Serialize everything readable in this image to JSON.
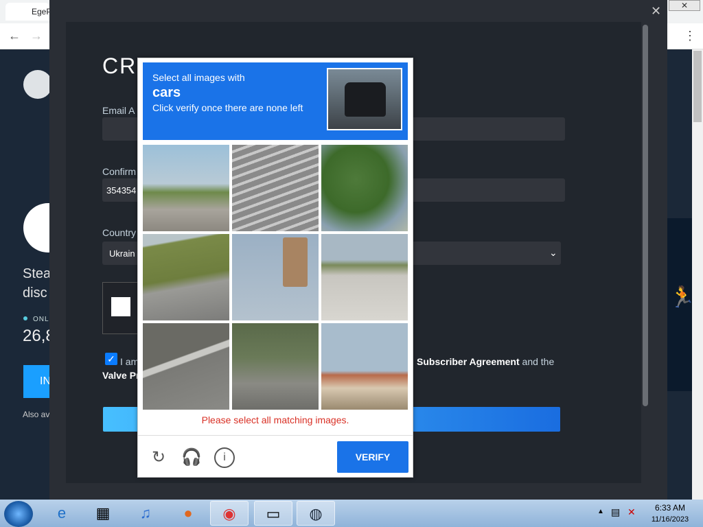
{
  "browser": {
    "tab_title": "EgeP",
    "window_close_glyph": "✕",
    "back_glyph": "←",
    "forward_glyph": "→",
    "menu_glyph": "⋮"
  },
  "steam_page": {
    "side_text_line1": "Stea",
    "side_text_line2": "disc",
    "online_label": "ONLI",
    "online_count": "26,8",
    "install_button": "IN",
    "also_available": "Also av",
    "accent_color": "#1a9fff"
  },
  "modal": {
    "close_glyph": "✕",
    "title": "CR",
    "email_label": "Email A",
    "confirm_label": "Confirm",
    "confirm_value": "354354",
    "country_label": "Country",
    "country_value": "Ukrain",
    "agree_prefix": "I am",
    "agree_link": "Subscriber Agreement",
    "agree_suffix": " and the",
    "valve_privacy": "Valve Pr"
  },
  "captcha": {
    "instruction": "Select all images with",
    "target": "cars",
    "sub_instruction": "Click verify once there are none left",
    "error_text": "Please select all matching images.",
    "verify_label": "VERIFY",
    "refresh_icon": "refresh-icon",
    "audio_icon": "headphones-icon",
    "info_icon": "info-icon",
    "tiles": [
      {
        "name": "tile-intersection"
      },
      {
        "name": "tile-crosswalk-stripes"
      },
      {
        "name": "tile-trees"
      },
      {
        "name": "tile-grass-road"
      },
      {
        "name": "tile-traffic-light"
      },
      {
        "name": "tile-road-car"
      },
      {
        "name": "tile-crosswalk-corner"
      },
      {
        "name": "tile-parking-lot"
      },
      {
        "name": "tile-palm-house"
      }
    ]
  },
  "taskbar": {
    "time": "6:33 AM",
    "date": "11/16/2023"
  }
}
